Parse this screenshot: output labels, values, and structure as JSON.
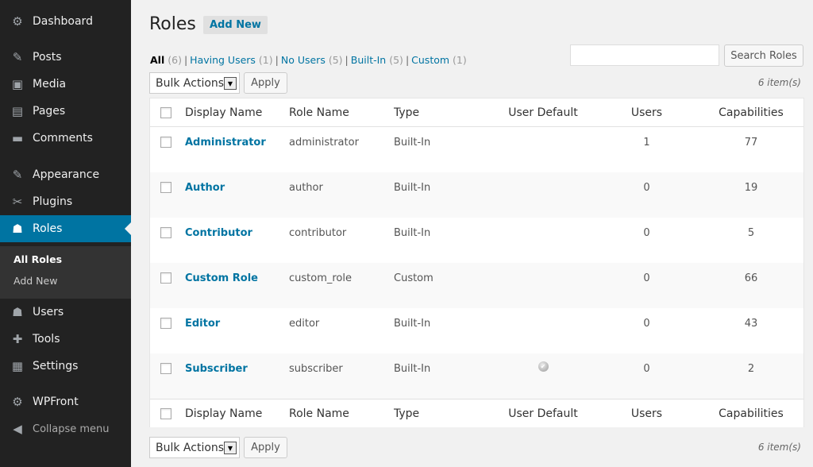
{
  "sidebar": {
    "items": [
      {
        "key": "dashboard",
        "label": "Dashboard",
        "icon": "dashboard-icon",
        "glyph": "⚙"
      },
      {
        "key": "posts",
        "label": "Posts",
        "icon": "pin-icon",
        "glyph": "📌"
      },
      {
        "key": "media",
        "label": "Media",
        "icon": "media-icon",
        "glyph": "▣"
      },
      {
        "key": "pages",
        "label": "Pages",
        "icon": "pages-icon",
        "glyph": "▤"
      },
      {
        "key": "comments",
        "label": "Comments",
        "icon": "comment-icon",
        "glyph": "▬"
      },
      {
        "key": "appearance",
        "label": "Appearance",
        "icon": "brush-icon",
        "glyph": "✎"
      },
      {
        "key": "plugins",
        "label": "Plugins",
        "icon": "plugin-icon",
        "glyph": "✂"
      },
      {
        "key": "roles",
        "label": "Roles",
        "icon": "roles-icon",
        "glyph": "👥"
      },
      {
        "key": "users",
        "label": "Users",
        "icon": "user-icon",
        "glyph": "👤"
      },
      {
        "key": "tools",
        "label": "Tools",
        "icon": "wrench-icon",
        "glyph": "🔧"
      },
      {
        "key": "settings",
        "label": "Settings",
        "icon": "settings-icon",
        "glyph": "▦"
      },
      {
        "key": "wpfront",
        "label": "WPFront",
        "icon": "gear-icon",
        "glyph": "⚙"
      },
      {
        "key": "collapse",
        "label": "Collapse menu",
        "icon": "collapse-icon",
        "glyph": "◀"
      }
    ],
    "submenu": {
      "all_roles": "All Roles",
      "add_new": "Add New"
    },
    "active_color": "#0074a2"
  },
  "page": {
    "title": "Roles",
    "add_new": "Add New",
    "filters": {
      "all": "All",
      "all_count": "(6)",
      "having_users": "Having Users",
      "having_users_count": "(1)",
      "no_users": "No Users",
      "no_users_count": "(5)",
      "built_in": "Built-In",
      "built_in_count": "(5)",
      "custom": "Custom",
      "custom_count": "(1)",
      "sep": "|"
    },
    "search": {
      "value": "",
      "button": "Search Roles"
    },
    "bulk": {
      "label": "Bulk Actions",
      "apply": "Apply"
    },
    "items_count": "6 item(s)"
  },
  "table": {
    "columns": [
      "Display Name",
      "Role Name",
      "Type",
      "User Default",
      "Users",
      "Capabilities"
    ],
    "rows": [
      {
        "display": "Administrator",
        "role": "administrator",
        "type": "Built-In",
        "default": "",
        "users": "1",
        "caps": "77"
      },
      {
        "display": "Author",
        "role": "author",
        "type": "Built-In",
        "default": "",
        "users": "0",
        "caps": "19"
      },
      {
        "display": "Contributor",
        "role": "contributor",
        "type": "Built-In",
        "default": "",
        "users": "0",
        "caps": "5"
      },
      {
        "display": "Custom Role",
        "role": "custom_role",
        "type": "Custom",
        "default": "",
        "users": "0",
        "caps": "66"
      },
      {
        "display": "Editor",
        "role": "editor",
        "type": "Built-In",
        "default": "",
        "users": "0",
        "caps": "43"
      },
      {
        "display": "Subscriber",
        "role": "subscriber",
        "type": "Built-In",
        "default": "✔",
        "users": "0",
        "caps": "2"
      }
    ]
  }
}
